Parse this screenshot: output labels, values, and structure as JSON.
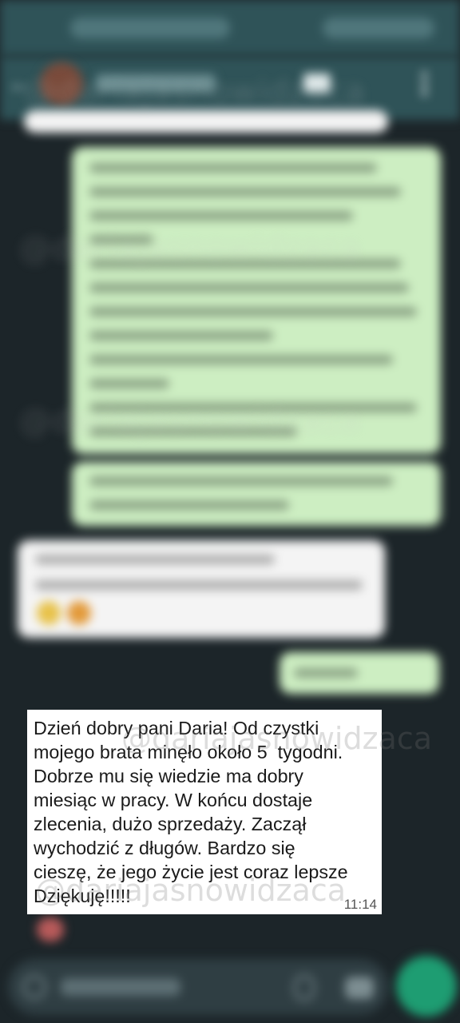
{
  "watermark": "@dariajasnowidzaca",
  "conversation": {
    "highlighted_message": {
      "text": "Dzień dobry pani Daria! Od czystki\nmojego brata minęło około 5  tygodni.\nDobrze mu się wiedzie ma dobry\nmiesiąc w pracy. W końcu dostaje\nzlecenia, dużo sprzedaży. Zaczął\nwychodzić z długów. Bardzo się\ncieszę, że jego życie jest coraz lepsze\nDziękuję!!!!!",
      "time": "11:14"
    }
  },
  "icons": {
    "back": "back-arrow-icon",
    "video": "video-call-icon",
    "menu": "more-vert-icon",
    "emoji": "emoji-icon",
    "attach": "attach-icon",
    "camera": "camera-icon",
    "mic": "mic-icon"
  }
}
